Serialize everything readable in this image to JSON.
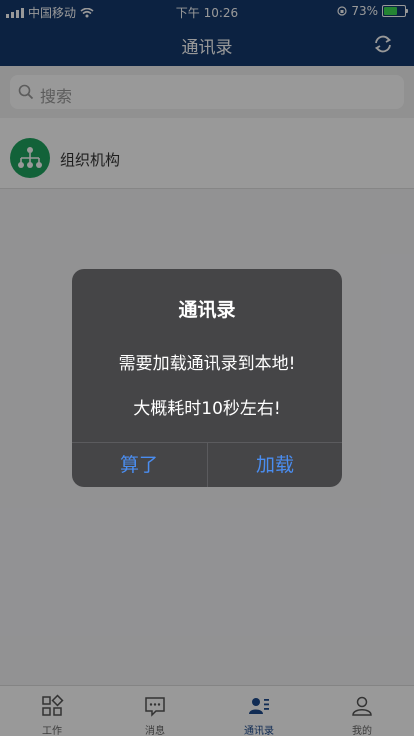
{
  "status_bar": {
    "carrier": "中国移动",
    "time": "下午 10:26",
    "battery": "73%",
    "battery_level": 0.73
  },
  "nav": {
    "title": "通讯录",
    "refresh_icon": "refresh-icon"
  },
  "search": {
    "placeholder": "搜索",
    "icon": "search-icon"
  },
  "content": {
    "org_label": "组织机构",
    "org_icon": "org-chart-icon"
  },
  "tabs": [
    {
      "label": "工作",
      "icon": "apps-grid-icon"
    },
    {
      "label": "消息",
      "icon": "chat-bubble-icon"
    },
    {
      "label": "通讯录",
      "icon": "contacts-icon",
      "active": true
    },
    {
      "label": "我的",
      "icon": "user-profile-icon"
    }
  ],
  "dialog": {
    "title": "通讯录",
    "line1": "需要加载通讯录到本地!",
    "line2": "大概耗时10秒左右!",
    "cancel_label": "算了",
    "confirm_label": "加载"
  },
  "colors": {
    "header": "#14396d",
    "accent": "#1d4a8c",
    "dialog_button": "#4a8df0",
    "org_icon_bg": "#1fa35f"
  }
}
